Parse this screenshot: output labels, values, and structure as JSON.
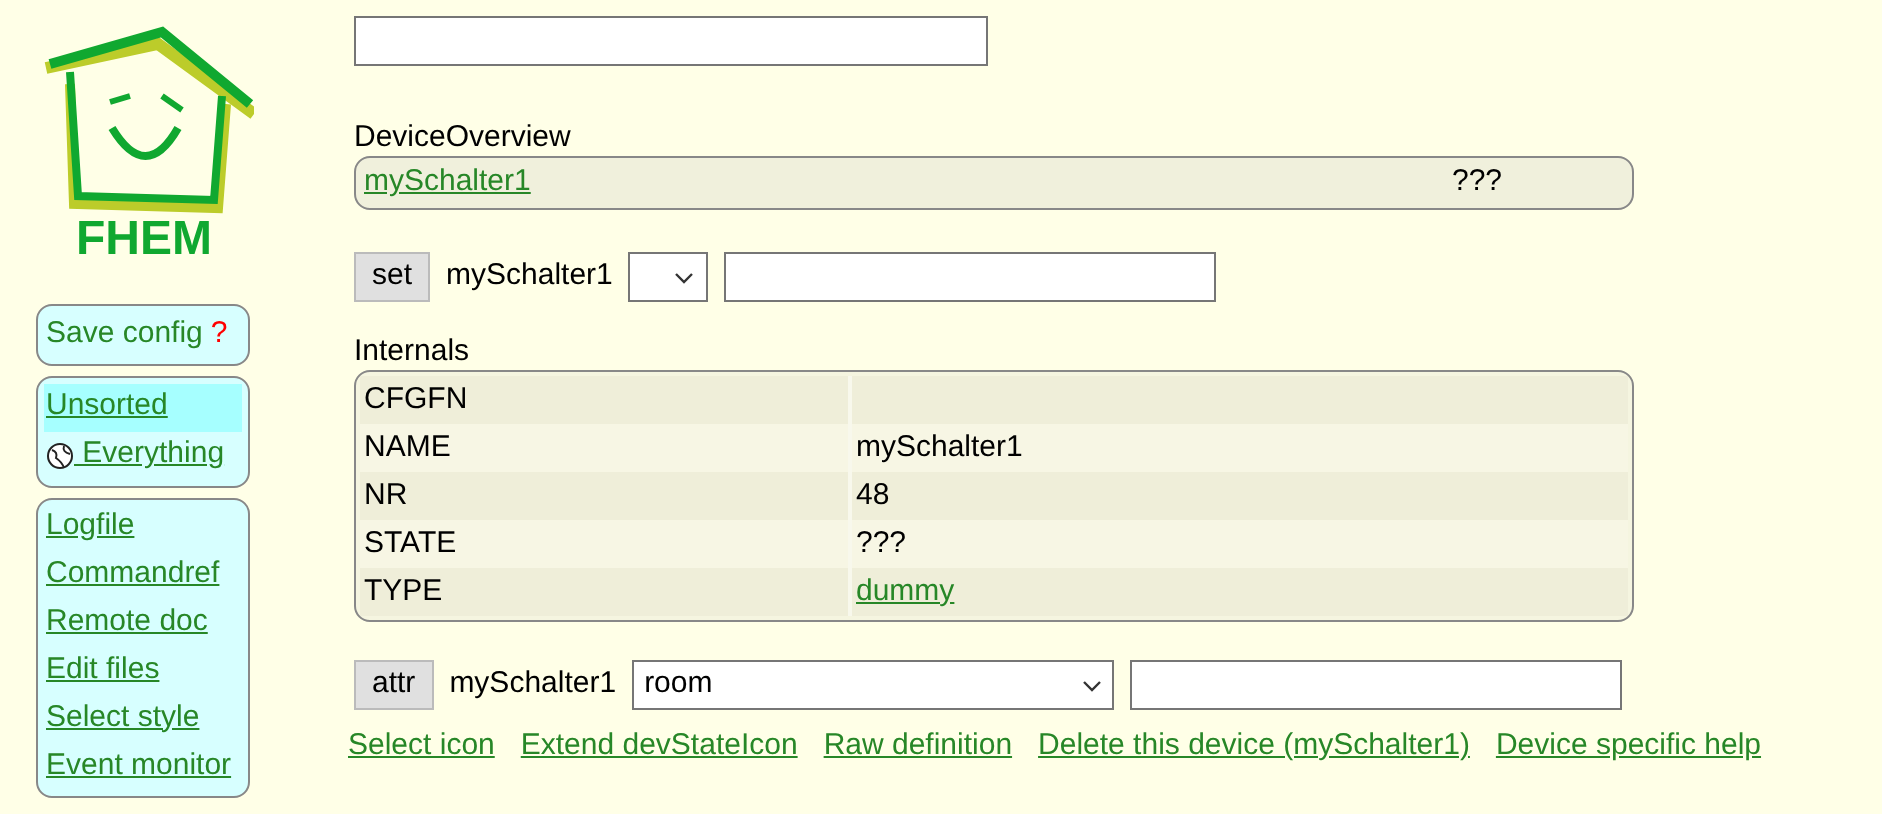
{
  "logo": {
    "text": "FHEM"
  },
  "sidebar": {
    "save": {
      "label": "Save config",
      "hint": "?"
    },
    "rooms": [
      {
        "label": "Unsorted",
        "selected": true,
        "kind": "plain"
      },
      {
        "label": " Everything",
        "selected": false,
        "kind": "globe"
      }
    ],
    "menu": [
      "Logfile",
      "Commandref",
      "Remote doc",
      "Edit files",
      "Select style",
      "Event monitor"
    ]
  },
  "overview": {
    "title": "DeviceOverview",
    "device": "mySchalter1",
    "state": "???"
  },
  "set": {
    "button": "set",
    "device": "mySchalter1"
  },
  "internals": {
    "title": "Internals",
    "rows": [
      {
        "name": "CFGFN",
        "value": "",
        "kind": "text"
      },
      {
        "name": "NAME",
        "value": "mySchalter1",
        "kind": "text"
      },
      {
        "name": "NR",
        "value": "48",
        "kind": "text"
      },
      {
        "name": "STATE",
        "value": "???",
        "kind": "text"
      },
      {
        "name": "TYPE",
        "value": "dummy",
        "kind": "link"
      }
    ]
  },
  "attr": {
    "button": "attr",
    "device": "mySchalter1",
    "select": "room"
  },
  "links": [
    "Select icon",
    "Extend devStateIcon",
    "Raw definition",
    "Delete this device (mySchalter1)",
    "Device specific help"
  ]
}
